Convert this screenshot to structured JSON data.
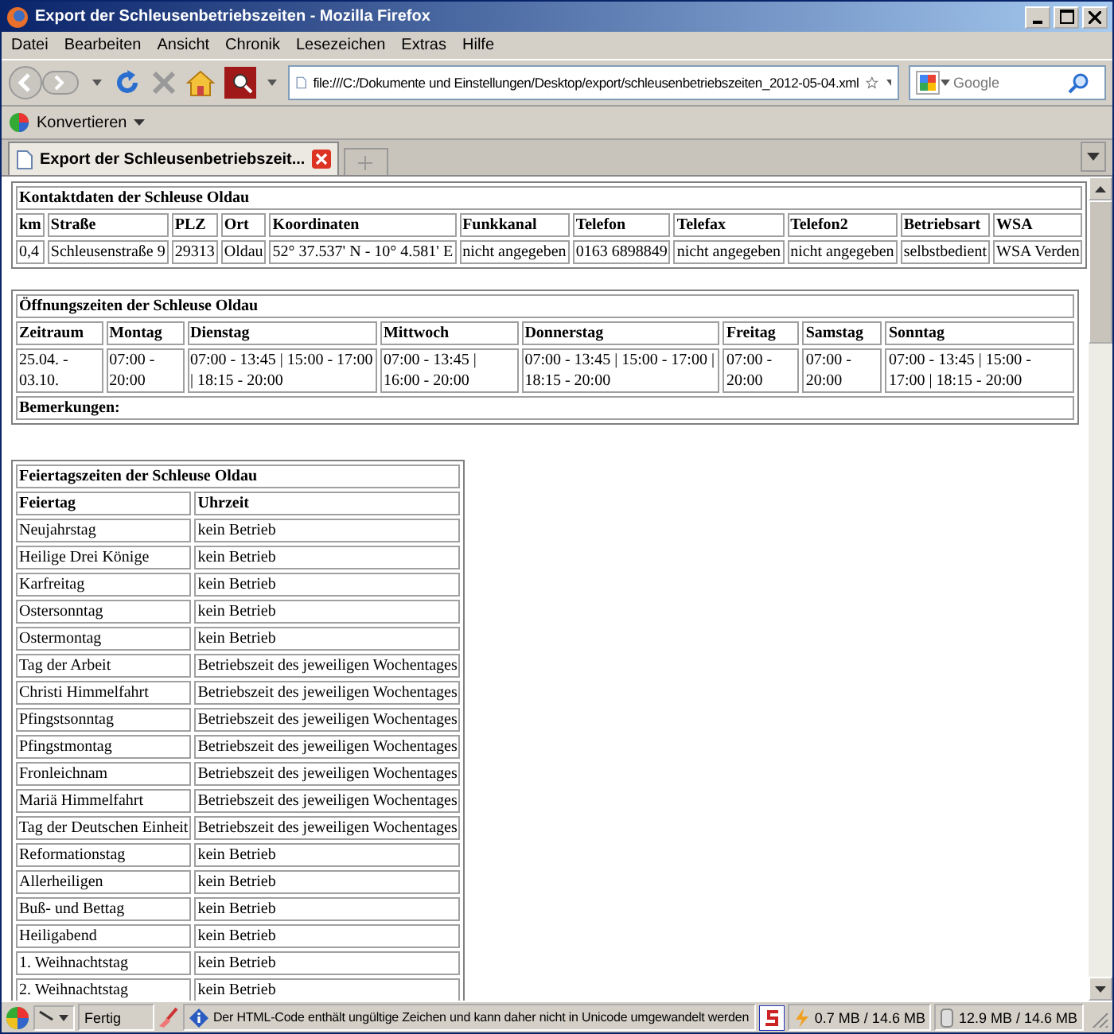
{
  "window": {
    "title": "Export der Schleusenbetriebszeiten - Mozilla Firefox"
  },
  "menu": [
    "Datei",
    "Bearbeiten",
    "Ansicht",
    "Chronik",
    "Lesezeichen",
    "Extras",
    "Hilfe"
  ],
  "address_bar": {
    "value": "file:///C:/Dokumente und Einstellungen/Desktop/export/schleusenbetriebszeiten_2012-05-04.xml"
  },
  "search": {
    "placeholder": "Google"
  },
  "bookmarks": [
    {
      "label": "Konvertieren"
    }
  ],
  "tabs": [
    {
      "label": "Export der Schleusenbetriebszeit...",
      "selected": true
    }
  ],
  "contact_table": {
    "title": "Kontaktdaten der Schleuse Oldau",
    "columns": [
      "km",
      "Straße",
      "PLZ",
      "Ort",
      "Koordinaten",
      "Funkkanal",
      "Telefon",
      "Telefax",
      "Telefon2",
      "Betriebsart",
      "WSA"
    ],
    "rows": [
      [
        "0,4",
        "Schleusenstraße 9",
        "29313",
        "Oldau",
        "52° 37.537' N - 10° 4.581' E",
        "nicht angegeben",
        "0163 6898849",
        "nicht angegeben",
        "nicht angegeben",
        "selbstbedient",
        "WSA Verden"
      ]
    ]
  },
  "hours_table": {
    "title": "Öffnungszeiten der Schleuse Oldau",
    "columns": [
      "Zeitraum",
      "Montag",
      "Dienstag",
      "Mittwoch",
      "Donnerstag",
      "Freitag",
      "Samstag",
      "Sonntag"
    ],
    "rows": [
      [
        "25.04. - 03.10.",
        "07:00 - 20:00",
        "07:00 - 13:45 | 15:00 - 17:00 | 18:15 - 20:00",
        "07:00 - 13:45 | 16:00 - 20:00",
        "07:00 - 13:45 | 15:00 - 17:00 | 18:15 - 20:00",
        "07:00 - 20:00",
        "07:00 - 20:00",
        "07:00 - 13:45 | 15:00 - 17:00 | 18:15 - 20:00"
      ]
    ],
    "remarks": "Bemerkungen:"
  },
  "holiday_table": {
    "title": "Feiertagszeiten der Schleuse Oldau",
    "columns": [
      "Feiertag",
      "Uhrzeit"
    ],
    "rows": [
      [
        "Neujahrstag",
        "kein Betrieb"
      ],
      [
        "Heilige Drei Könige",
        "kein Betrieb"
      ],
      [
        "Karfreitag",
        "kein Betrieb"
      ],
      [
        "Ostersonntag",
        "kein Betrieb"
      ],
      [
        "Ostermontag",
        "kein Betrieb"
      ],
      [
        "Tag der Arbeit",
        "Betriebszeit des jeweiligen Wochentages"
      ],
      [
        "Christi Himmelfahrt",
        "Betriebszeit des jeweiligen Wochentages"
      ],
      [
        "Pfingstsonntag",
        "Betriebszeit des jeweiligen Wochentages"
      ],
      [
        "Pfingstmontag",
        "Betriebszeit des jeweiligen Wochentages"
      ],
      [
        "Fronleichnam",
        "Betriebszeit des jeweiligen Wochentages"
      ],
      [
        "Mariä Himmelfahrt",
        "Betriebszeit des jeweiligen Wochentages"
      ],
      [
        "Tag der Deutschen Einheit",
        "Betriebszeit des jeweiligen Wochentages"
      ],
      [
        "Reformationstag",
        "kein Betrieb"
      ],
      [
        "Allerheiligen",
        "kein Betrieb"
      ],
      [
        "Buß- und Bettag",
        "kein Betrieb"
      ],
      [
        "Heiligabend",
        "kein Betrieb"
      ],
      [
        "1. Weihnachtstag",
        "kein Betrieb"
      ],
      [
        "2. Weihnachtstag",
        "kein Betrieb"
      ]
    ]
  },
  "status_bar": {
    "status": "Fertig",
    "message": "Der HTML-Code enthält ungültige Zeichen und kann daher nicht in Unicode umgewandelt werden",
    "memory_1": "0.7 MB / 14.6 MB",
    "memory_2": "12.9 MB / 14.6 MB"
  }
}
